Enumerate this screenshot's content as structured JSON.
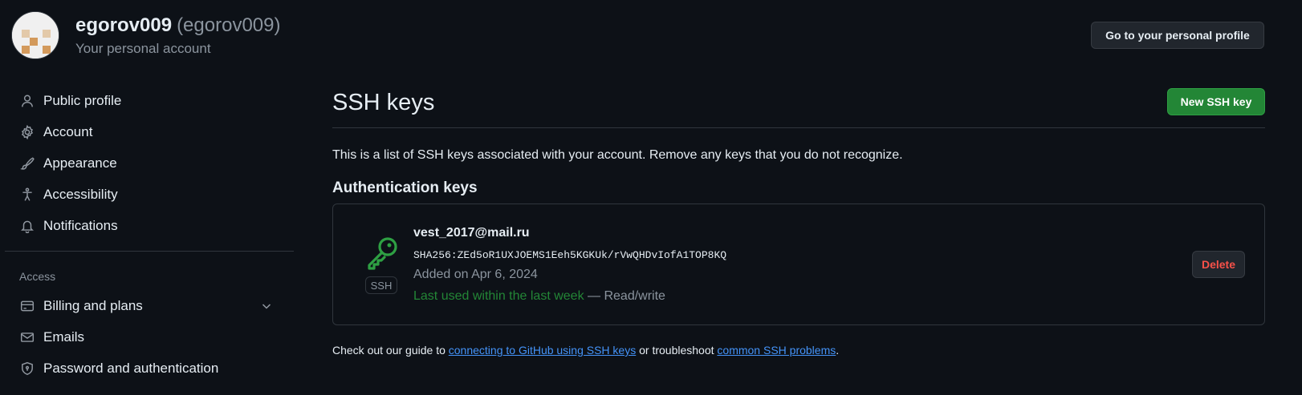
{
  "header": {
    "display_name": "egorov009",
    "login": "(egorov009)",
    "subtitle": "Your personal account",
    "profile_button": "Go to your personal profile"
  },
  "sidebar": {
    "items": [
      {
        "label": "Public profile",
        "icon": "person-icon"
      },
      {
        "label": "Account",
        "icon": "gear-icon"
      },
      {
        "label": "Appearance",
        "icon": "paintbrush-icon"
      },
      {
        "label": "Accessibility",
        "icon": "accessibility-icon"
      },
      {
        "label": "Notifications",
        "icon": "bell-icon"
      }
    ],
    "access_heading": "Access",
    "access_items": [
      {
        "label": "Billing and plans",
        "icon": "credit-card-icon"
      },
      {
        "label": "Emails",
        "icon": "mail-icon"
      },
      {
        "label": "Password and authentication",
        "icon": "shield-lock-icon"
      }
    ]
  },
  "main": {
    "title": "SSH keys",
    "new_button": "New SSH key",
    "intro": "This is a list of SSH keys associated with your account. Remove any keys that you do not recognize.",
    "section_heading": "Authentication keys",
    "key": {
      "title": "vest_2017@mail.ru",
      "fingerprint": "SHA256:ZEd5oR1UXJOEMS1Eeh5KGKUk/rVwQHDvIofA1TOP8KQ",
      "added": "Added on Apr 6, 2024",
      "last_used": "Last used within the last week",
      "access": "— Read/write",
      "badge": "SSH",
      "delete_label": "Delete"
    },
    "footer": {
      "prefix": "Check out our guide to ",
      "link1": "connecting to GitHub using SSH keys",
      "middle": " or troubleshoot ",
      "link2": "common SSH problems",
      "suffix": "."
    }
  },
  "colors": {
    "background": "#0d1117",
    "accent_green": "#238636",
    "link_blue": "#4493f8",
    "danger_red": "#f85149"
  }
}
